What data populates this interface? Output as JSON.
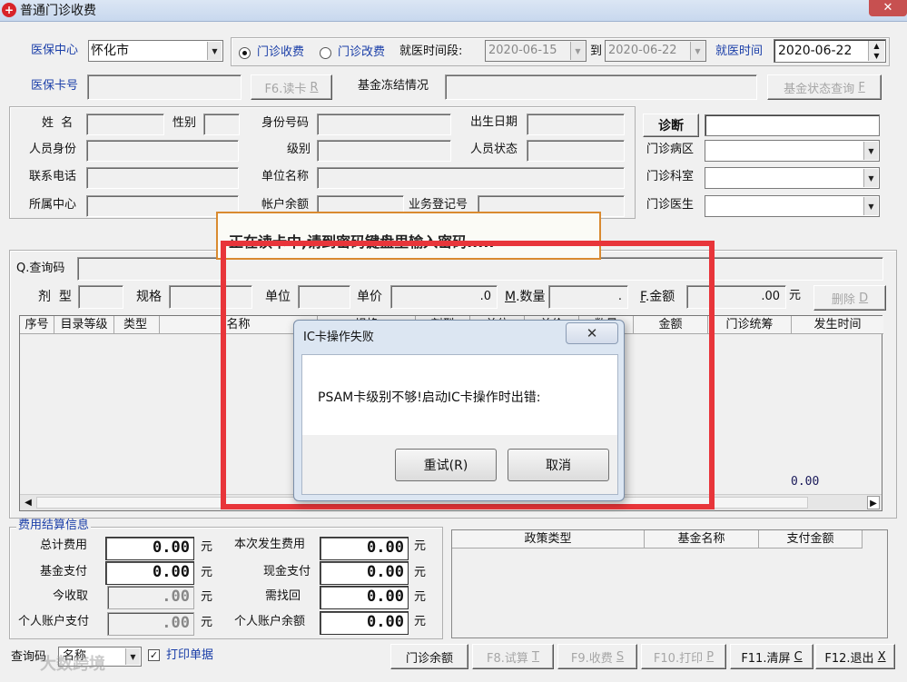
{
  "window": {
    "title": "普通门诊收费"
  },
  "top": {
    "center_label": "医保中心",
    "center_value": "怀化市",
    "radio_fee": "门诊收费",
    "radio_change": "门诊改费",
    "period_label": "就医时间段:",
    "date_from": "2020-06-15",
    "to_label": "到",
    "date_to": "2020-06-22",
    "visit_time_label": "就医时间",
    "visit_time": "2020-06-22",
    "card_label": "医保卡号",
    "read_card_btn": "F6.读卡",
    "read_card_key": "R",
    "fund_freeze_label": "基金冻结情况",
    "fund_status_btn": "基金状态查询",
    "fund_status_key": "F"
  },
  "person": {
    "name": "姓  名",
    "gender": "性别",
    "id_no": "身份号码",
    "birth": "出生日期",
    "identity": "人员身份",
    "level": "级别",
    "status": "人员状态",
    "phone": "联系电话",
    "unit_name": "单位名称",
    "center": "所属中心",
    "balance": "帐户余额",
    "reg_no": "业务登记号"
  },
  "clinic": {
    "diag_btn": "诊断",
    "area": "门诊病区",
    "dept": "门诊科室",
    "doctor": "门诊医生"
  },
  "toast": {
    "text": "正在读卡中,请到密码键盘里输入密码....."
  },
  "query": {
    "query_label": "Q.查询码",
    "dosage": "剂  型",
    "spec": "规格",
    "unit": "单位",
    "price": "单价",
    "price_val": ".0",
    "qty_key": "M",
    "qty": ".数量",
    "qty_val": ".",
    "amount_key": "F",
    "amount": ".金额",
    "amount_val": ".00",
    "yuan": "元",
    "delete_btn": "删除",
    "delete_key": "D"
  },
  "table": {
    "headers": [
      "序号",
      "目录等级",
      "类型",
      "名称",
      "规格",
      "剂型",
      "单位",
      "单价",
      "数量",
      "金额",
      "门诊统筹",
      "发生时间"
    ],
    "total": "0.00"
  },
  "settlement": {
    "title": "费用结算信息",
    "total_fee_label": "总计费用",
    "total_fee": "0.00",
    "fund_pay_label": "基金支付",
    "fund_pay": "0.00",
    "receivable_label": "今收取",
    "receivable": ".00",
    "acct_pay_label": "个人账户支付",
    "acct_pay": ".00",
    "current_fee_label": "本次发生费用",
    "current_fee": "0.00",
    "cash_pay_label": "现金支付",
    "cash_pay": "0.00",
    "change_label": "需找回",
    "change": "0.00",
    "acct_balance_label": "个人账户余额",
    "acct_balance": "0.00",
    "yuan": "元"
  },
  "policy": {
    "headers": [
      "政策类型",
      "基金名称",
      "支付金额"
    ]
  },
  "bottom": {
    "query_label": "查询码",
    "query_sel": "名称",
    "print_label": "打印单据",
    "buttons": [
      {
        "label": "门诊余额",
        "key": ""
      },
      {
        "label": "F8.试算",
        "key": "T"
      },
      {
        "label": "F9.收费",
        "key": "S"
      },
      {
        "label": "F10.打印",
        "key": "P"
      },
      {
        "label": "F11.清屏",
        "key": "C"
      },
      {
        "label": "F12.退出",
        "key": "X"
      }
    ],
    "watermark": "大数跨境"
  },
  "dialog": {
    "title": "IC卡操作失败",
    "message": "PSAM卡级别不够!启动IC卡操作时出错:",
    "retry": "重试(R)",
    "cancel": "取消"
  },
  "colors": {
    "highlight_box": "#e8353a",
    "title_blue": "#1a3ea8",
    "toast_border": "#d98a30"
  }
}
